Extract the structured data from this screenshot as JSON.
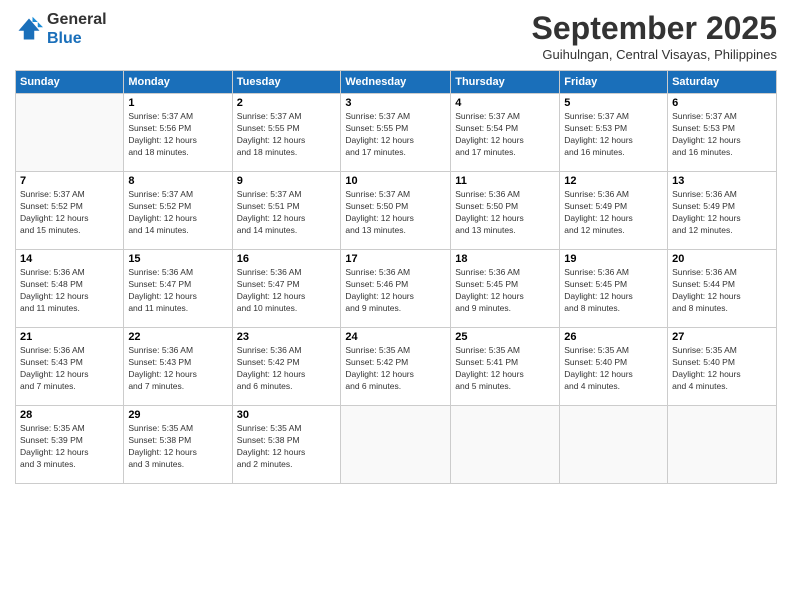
{
  "logo": {
    "general": "General",
    "blue": "Blue"
  },
  "header": {
    "month": "September 2025",
    "location": "Guihulngan, Central Visayas, Philippines"
  },
  "weekdays": [
    "Sunday",
    "Monday",
    "Tuesday",
    "Wednesday",
    "Thursday",
    "Friday",
    "Saturday"
  ],
  "weeks": [
    [
      {
        "day": "",
        "info": ""
      },
      {
        "day": "1",
        "info": "Sunrise: 5:37 AM\nSunset: 5:56 PM\nDaylight: 12 hours\nand 18 minutes."
      },
      {
        "day": "2",
        "info": "Sunrise: 5:37 AM\nSunset: 5:55 PM\nDaylight: 12 hours\nand 18 minutes."
      },
      {
        "day": "3",
        "info": "Sunrise: 5:37 AM\nSunset: 5:55 PM\nDaylight: 12 hours\nand 17 minutes."
      },
      {
        "day": "4",
        "info": "Sunrise: 5:37 AM\nSunset: 5:54 PM\nDaylight: 12 hours\nand 17 minutes."
      },
      {
        "day": "5",
        "info": "Sunrise: 5:37 AM\nSunset: 5:53 PM\nDaylight: 12 hours\nand 16 minutes."
      },
      {
        "day": "6",
        "info": "Sunrise: 5:37 AM\nSunset: 5:53 PM\nDaylight: 12 hours\nand 16 minutes."
      }
    ],
    [
      {
        "day": "7",
        "info": "Sunrise: 5:37 AM\nSunset: 5:52 PM\nDaylight: 12 hours\nand 15 minutes."
      },
      {
        "day": "8",
        "info": "Sunrise: 5:37 AM\nSunset: 5:52 PM\nDaylight: 12 hours\nand 14 minutes."
      },
      {
        "day": "9",
        "info": "Sunrise: 5:37 AM\nSunset: 5:51 PM\nDaylight: 12 hours\nand 14 minutes."
      },
      {
        "day": "10",
        "info": "Sunrise: 5:37 AM\nSunset: 5:50 PM\nDaylight: 12 hours\nand 13 minutes."
      },
      {
        "day": "11",
        "info": "Sunrise: 5:36 AM\nSunset: 5:50 PM\nDaylight: 12 hours\nand 13 minutes."
      },
      {
        "day": "12",
        "info": "Sunrise: 5:36 AM\nSunset: 5:49 PM\nDaylight: 12 hours\nand 12 minutes."
      },
      {
        "day": "13",
        "info": "Sunrise: 5:36 AM\nSunset: 5:49 PM\nDaylight: 12 hours\nand 12 minutes."
      }
    ],
    [
      {
        "day": "14",
        "info": "Sunrise: 5:36 AM\nSunset: 5:48 PM\nDaylight: 12 hours\nand 11 minutes."
      },
      {
        "day": "15",
        "info": "Sunrise: 5:36 AM\nSunset: 5:47 PM\nDaylight: 12 hours\nand 11 minutes."
      },
      {
        "day": "16",
        "info": "Sunrise: 5:36 AM\nSunset: 5:47 PM\nDaylight: 12 hours\nand 10 minutes."
      },
      {
        "day": "17",
        "info": "Sunrise: 5:36 AM\nSunset: 5:46 PM\nDaylight: 12 hours\nand 9 minutes."
      },
      {
        "day": "18",
        "info": "Sunrise: 5:36 AM\nSunset: 5:45 PM\nDaylight: 12 hours\nand 9 minutes."
      },
      {
        "day": "19",
        "info": "Sunrise: 5:36 AM\nSunset: 5:45 PM\nDaylight: 12 hours\nand 8 minutes."
      },
      {
        "day": "20",
        "info": "Sunrise: 5:36 AM\nSunset: 5:44 PM\nDaylight: 12 hours\nand 8 minutes."
      }
    ],
    [
      {
        "day": "21",
        "info": "Sunrise: 5:36 AM\nSunset: 5:43 PM\nDaylight: 12 hours\nand 7 minutes."
      },
      {
        "day": "22",
        "info": "Sunrise: 5:36 AM\nSunset: 5:43 PM\nDaylight: 12 hours\nand 7 minutes."
      },
      {
        "day": "23",
        "info": "Sunrise: 5:36 AM\nSunset: 5:42 PM\nDaylight: 12 hours\nand 6 minutes."
      },
      {
        "day": "24",
        "info": "Sunrise: 5:35 AM\nSunset: 5:42 PM\nDaylight: 12 hours\nand 6 minutes."
      },
      {
        "day": "25",
        "info": "Sunrise: 5:35 AM\nSunset: 5:41 PM\nDaylight: 12 hours\nand 5 minutes."
      },
      {
        "day": "26",
        "info": "Sunrise: 5:35 AM\nSunset: 5:40 PM\nDaylight: 12 hours\nand 4 minutes."
      },
      {
        "day": "27",
        "info": "Sunrise: 5:35 AM\nSunset: 5:40 PM\nDaylight: 12 hours\nand 4 minutes."
      }
    ],
    [
      {
        "day": "28",
        "info": "Sunrise: 5:35 AM\nSunset: 5:39 PM\nDaylight: 12 hours\nand 3 minutes."
      },
      {
        "day": "29",
        "info": "Sunrise: 5:35 AM\nSunset: 5:38 PM\nDaylight: 12 hours\nand 3 minutes."
      },
      {
        "day": "30",
        "info": "Sunrise: 5:35 AM\nSunset: 5:38 PM\nDaylight: 12 hours\nand 2 minutes."
      },
      {
        "day": "",
        "info": ""
      },
      {
        "day": "",
        "info": ""
      },
      {
        "day": "",
        "info": ""
      },
      {
        "day": "",
        "info": ""
      }
    ]
  ]
}
